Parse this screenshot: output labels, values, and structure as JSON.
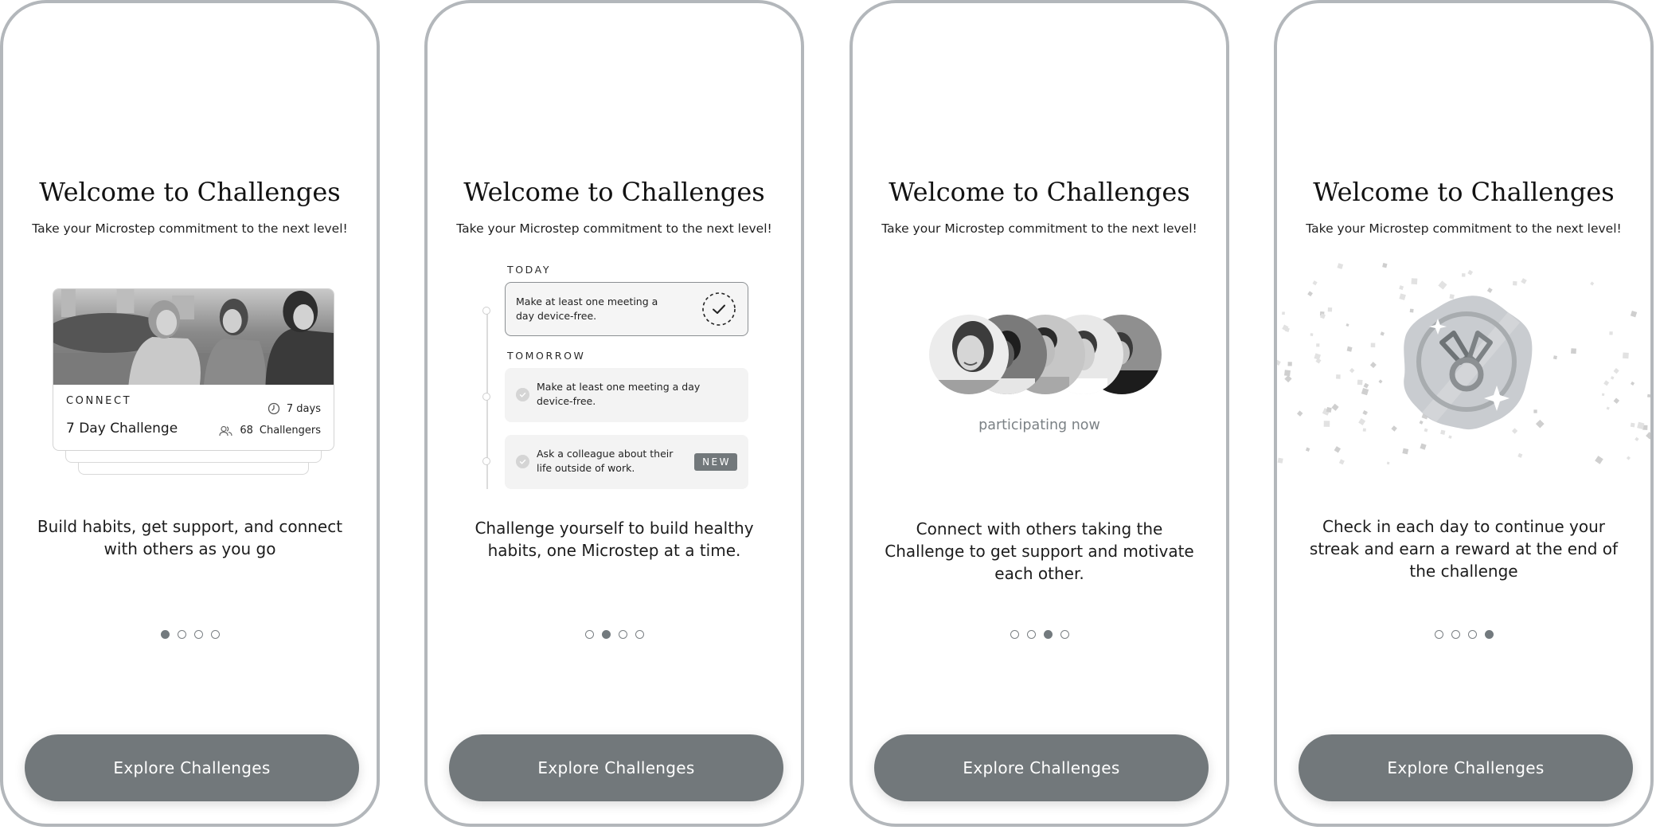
{
  "screens": [
    {
      "title": "Welcome to Challenges",
      "subtitle": "Take your Microstep commitment to the next level!",
      "card": {
        "category": "CONNECT",
        "name": "7 Day Challenge",
        "duration": "7 days",
        "challengers_count": "68",
        "challengers_label": "Challengers",
        "photo_icon": "group-photo-icon"
      },
      "body": "Build habits, get support, and connect with others as you go",
      "page_index": 0,
      "cta": "Explore Challenges"
    },
    {
      "title": "Welcome to Challenges",
      "subtitle": "Take your Microstep commitment to the next level!",
      "timeline": {
        "today_label": "TODAY",
        "today_step": "Make at least one meeting a day device-free.",
        "tomorrow_label": "TOMORROW",
        "tomorrow_steps": [
          {
            "text": "Make at least one meeting a day device-free.",
            "badge": ""
          },
          {
            "text": "Ask a colleague about their life outside of work.",
            "badge": "NEW"
          }
        ]
      },
      "body": "Challenge yourself to build healthy habits, one Microstep at a time.",
      "page_index": 1,
      "cta": "Explore Challenges"
    },
    {
      "title": "Welcome to Challenges",
      "subtitle": "Take your Microstep commitment to the next level!",
      "participants_avatars": 5,
      "participating_label": "participating now",
      "body": "Connect with others taking the Challenge to get support and motivate each other.",
      "page_index": 2,
      "cta": "Explore Challenges"
    },
    {
      "title": "Welcome to Challenges",
      "subtitle": "Take your Microstep commitment to the next level!",
      "reward_icon": "medal-badge-icon",
      "body": "Check in each day to continue your streak and earn a reward at the end of the challenge",
      "page_index": 3,
      "cta": "Explore Challenges"
    }
  ],
  "pagination": {
    "total": 4
  },
  "colors": {
    "button": "#72787b",
    "frame": "#b3b7bb",
    "dot_active": "#737a7e"
  }
}
